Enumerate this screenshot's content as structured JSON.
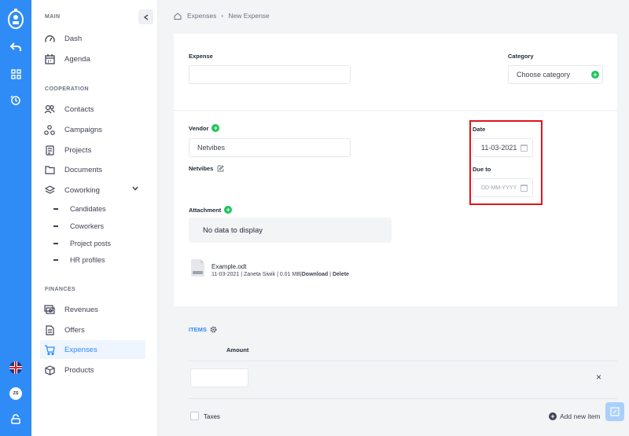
{
  "rail": {
    "icons": [
      "app-logo-icon",
      "back-arrow-icon",
      "apps-grid-icon",
      "refresh-timer-icon",
      "uk-flag-icon",
      "avatar",
      "lock-icon"
    ],
    "avatar_initials": "ZS"
  },
  "sidebar": {
    "main_title": "MAIN",
    "cooperation_title": "COOPERATION",
    "finances_title": "FINANCES",
    "main_items": [
      {
        "label": "Dash",
        "icon": "speedometer-icon"
      },
      {
        "label": "Agenda",
        "icon": "calendar-icon"
      }
    ],
    "coop_items": [
      {
        "label": "Contacts",
        "icon": "contacts-icon"
      },
      {
        "label": "Campaigns",
        "icon": "campaigns-icon"
      },
      {
        "label": "Projects",
        "icon": "projects-icon"
      },
      {
        "label": "Documents",
        "icon": "documents-icon"
      },
      {
        "label": "Coworking",
        "icon": "layers-icon"
      }
    ],
    "coworking_sub": [
      "Candidates",
      "Coworkers",
      "Project posts",
      "HR profiles"
    ],
    "finance_items": [
      {
        "label": "Revenues",
        "icon": "revenues-icon"
      },
      {
        "label": "Offers",
        "icon": "offers-icon"
      },
      {
        "label": "Expenses",
        "icon": "cart-icon",
        "active": true
      },
      {
        "label": "Products",
        "icon": "box-icon"
      }
    ]
  },
  "breadcrumb": {
    "home": "Expenses",
    "separator": "•",
    "current": "New Expense"
  },
  "form": {
    "expense_label": "Expense",
    "expense_value": "",
    "category_label": "Category",
    "category_placeholder": "Choose category",
    "vendor_label": "Vendor",
    "vendor_value": "Netvibes",
    "vendor_name": "Netvibes",
    "date_label": "Date",
    "date_value": "11-03-2021",
    "due_label": "Due to",
    "due_placeholder": "DD-MM-YYYY",
    "attachment_label": "Attachment",
    "no_data": "No data to display",
    "file": {
      "name": "Example.odt",
      "date": "11-03-2021",
      "author": "Zaneta Siwik",
      "size": "0.01 MB",
      "download": "Download",
      "delete": "Delete",
      "divider": "|"
    },
    "items_label": "ITEMS",
    "amount_label": "Amount",
    "amount_value": "",
    "remove_symbol": "×",
    "taxes_label": "Taxes",
    "add_item": "Add new item"
  },
  "colors": {
    "accent": "#2f8cf7",
    "success": "#1bc55a",
    "highlight": "#e3131b"
  }
}
